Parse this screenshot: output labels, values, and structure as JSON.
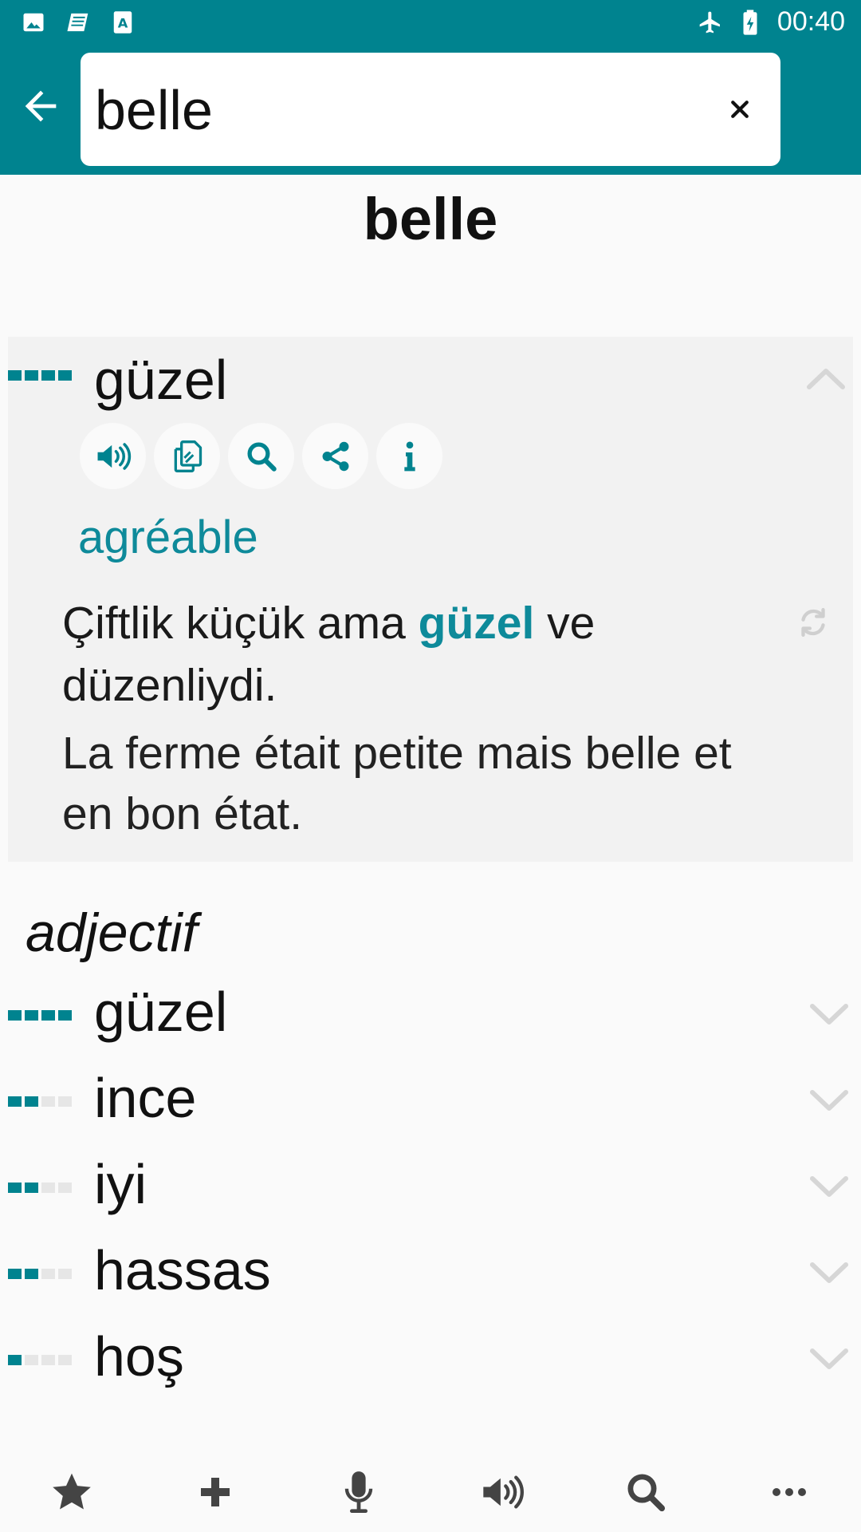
{
  "status_bar": {
    "time": "00:40",
    "left_icons": [
      "image-icon",
      "book-icon",
      "font-icon"
    ],
    "right_icons": [
      "airplane-mode-icon",
      "battery-charging-icon"
    ]
  },
  "app_bar": {
    "back_icon": "arrow-left-icon",
    "search": {
      "value": "belle",
      "placeholder": ""
    },
    "clear_icon": "close-icon"
  },
  "headword": "belle",
  "entry_card": {
    "word": "güzel",
    "frequency": 4,
    "expanded": true,
    "actions": [
      "speaker-icon",
      "copy-icon",
      "search-icon",
      "share-icon",
      "info-icon"
    ],
    "synonym": "agréable",
    "example": {
      "tr_before": "Çiftlik küçük ama ",
      "tr_highlight": "güzel",
      "tr_after": " ve düzenliydi.",
      "fr": "La ferme était petite mais belle et en bon état."
    }
  },
  "part_of_speech": "adjectif",
  "translations": [
    {
      "word": "güzel",
      "frequency": 4
    },
    {
      "word": "ince",
      "frequency": 2
    },
    {
      "word": "iyi",
      "frequency": 2
    },
    {
      "word": "hassas",
      "frequency": 2
    },
    {
      "word": "hoş",
      "frequency": 1
    }
  ],
  "bottom_bar": [
    "star-icon",
    "plus-icon",
    "microphone-icon",
    "speaker-icon",
    "search-icon",
    "more-icon"
  ],
  "colors": {
    "primary": "#00838f",
    "accent_text": "#0e8a9a",
    "card_bg": "#f2f2f2",
    "page_bg": "#fafafa"
  }
}
